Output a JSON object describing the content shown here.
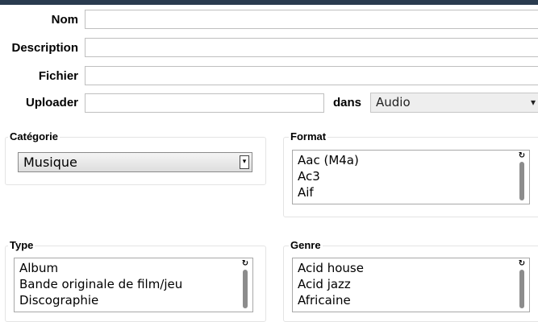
{
  "form": {
    "nom_label": "Nom",
    "description_label": "Description",
    "fichier_label": "Fichier",
    "uploader_label": "Uploader",
    "dans_label": "dans",
    "dans_value": "Audio"
  },
  "categorie": {
    "legend": "Catégorie",
    "selected": "Musique"
  },
  "format": {
    "legend": "Format",
    "options": [
      "Aac (M4a)",
      "Ac3",
      "Aif"
    ]
  },
  "type": {
    "legend": "Type",
    "options": [
      "Album",
      "Bande originale de film/jeu",
      "Discographie"
    ]
  },
  "genre": {
    "legend": "Genre",
    "options": [
      "Acid house",
      "Acid jazz",
      "Africaine"
    ]
  },
  "colors": {
    "topbar": "#2a3b4f",
    "field_border": "#bfbfbf",
    "scroll_thumb": "#8c8c8c"
  }
}
